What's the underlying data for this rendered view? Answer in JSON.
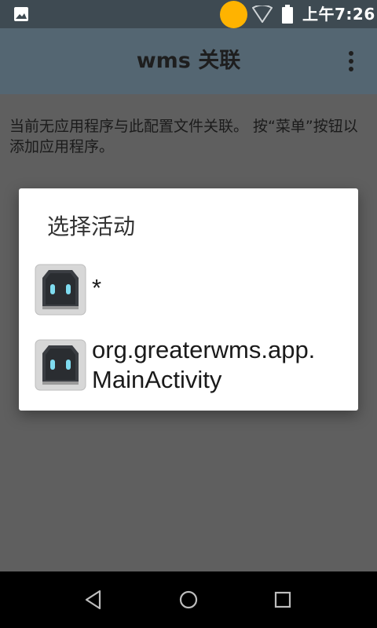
{
  "status_bar": {
    "time": "上午7:26",
    "icons": [
      "gallery-icon",
      "notification-dot",
      "wifi-icon",
      "battery-icon"
    ],
    "dot_color": "#ffb300"
  },
  "app_bar": {
    "title": "wms 关联",
    "overflow_icon": "more-vert-icon",
    "background": "#546672"
  },
  "message": "当前无应用程序与此配置文件关联。 按“菜单”按钮以添加应用程序。",
  "dialog": {
    "title": "选择活动",
    "items": [
      {
        "icon": "app-robot-icon",
        "label": "*"
      },
      {
        "icon": "app-robot-icon",
        "label": "org.greaterwms.app.\nMainActivity"
      }
    ]
  },
  "nav_bar": {
    "buttons": [
      "back-icon",
      "home-icon",
      "recents-icon"
    ]
  }
}
